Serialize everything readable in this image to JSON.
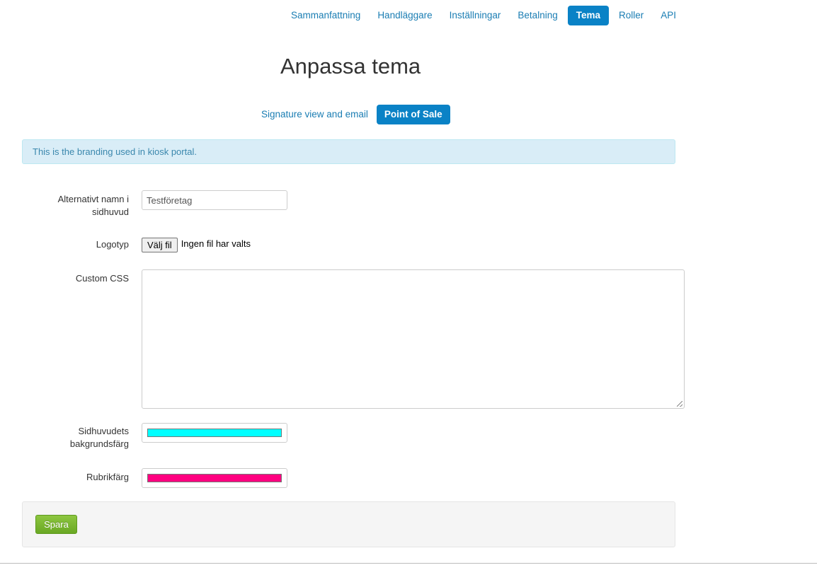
{
  "nav": {
    "items": [
      {
        "label": "Sammanfattning",
        "active": false
      },
      {
        "label": "Handläggare",
        "active": false
      },
      {
        "label": "Inställningar",
        "active": false
      },
      {
        "label": "Betalning",
        "active": false
      },
      {
        "label": "Tema",
        "active": true
      },
      {
        "label": "Roller",
        "active": false
      },
      {
        "label": "API",
        "active": false
      }
    ]
  },
  "page": {
    "title": "Anpassa tema"
  },
  "subnav": {
    "items": [
      {
        "label": "Signature view and email",
        "active": false
      },
      {
        "label": "Point of Sale",
        "active": true
      }
    ]
  },
  "alert": {
    "text": "This is the branding used in kiosk portal."
  },
  "form": {
    "alt_name": {
      "label": "Alternativt namn i sidhuvud",
      "value": "Testföretag"
    },
    "logo": {
      "label": "Logotyp",
      "button": "Välj fil",
      "status": "Ingen fil har valts"
    },
    "custom_css": {
      "label": "Custom CSS",
      "value": ""
    },
    "header_bg": {
      "label": "Sidhuvudets bakgrundsfärg",
      "color": "#00ffff"
    },
    "heading_color": {
      "label": "Rubrikfärg",
      "color": "#ff0080"
    },
    "save": "Spara"
  },
  "colors": {
    "accent": "#0a82c6",
    "link": "#1a7db3",
    "save": "#78b62f",
    "alert_bg": "#d9edf7"
  }
}
